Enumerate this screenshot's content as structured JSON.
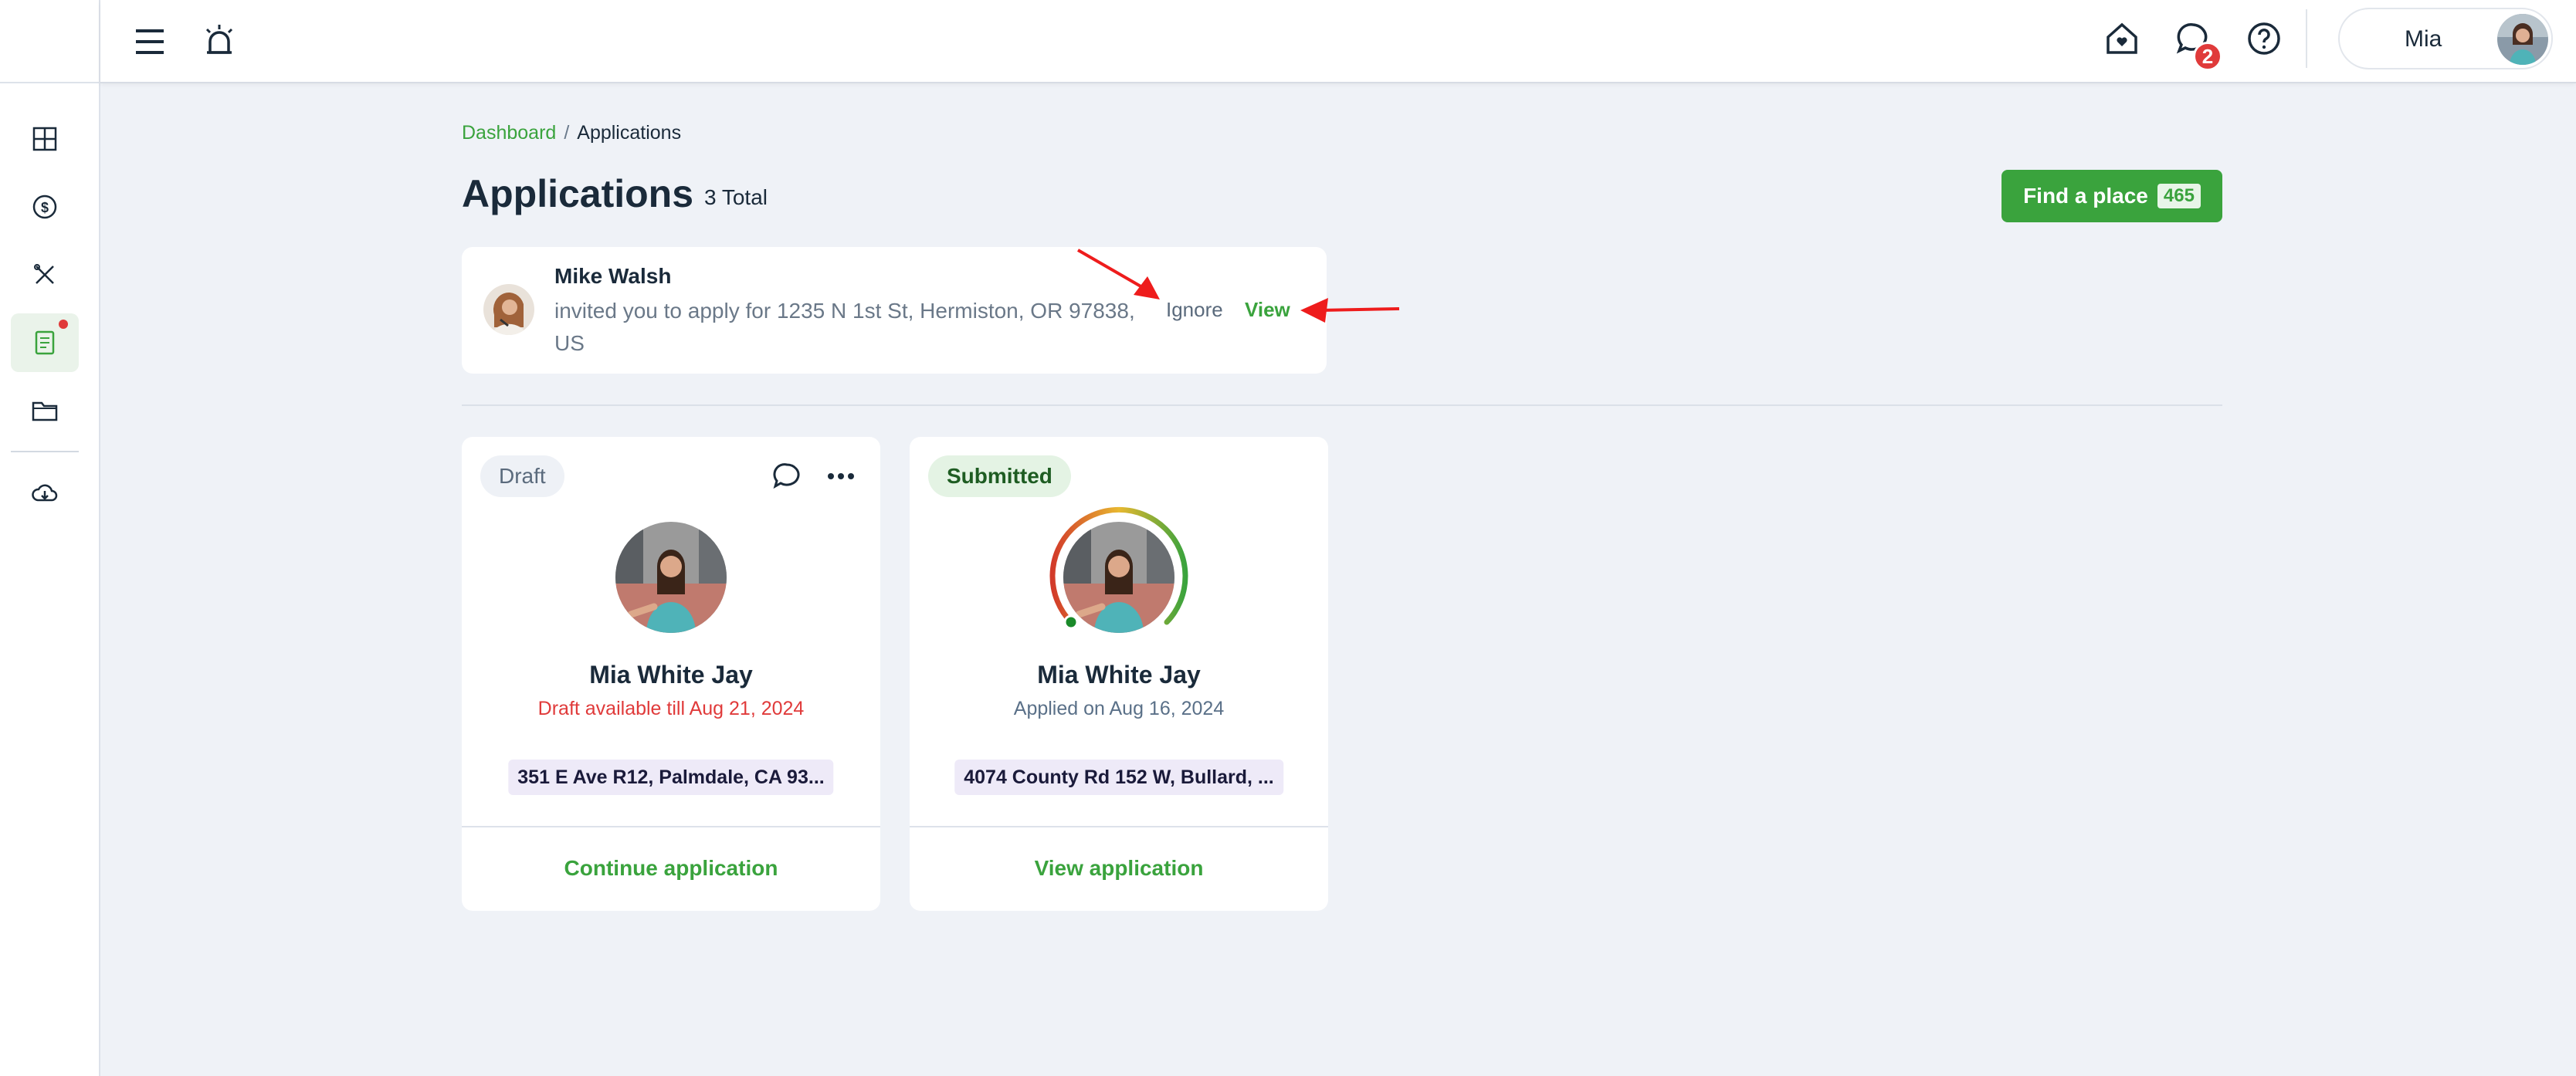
{
  "topbar": {
    "messages_badge": "2",
    "user_name": "Mia"
  },
  "breadcrumb": {
    "items": [
      {
        "label": "Dashboard"
      },
      {
        "label": "Applications"
      }
    ],
    "separator": "/"
  },
  "page": {
    "title": "Applications",
    "total_label": "3 Total",
    "find_button_label": "Find a place",
    "find_button_count": "465"
  },
  "invitation": {
    "sender": "Mike Walsh",
    "message": "invited you to apply for 1235 N 1st St, Hermiston, OR 97838, US",
    "ignore_label": "Ignore",
    "view_label": "View"
  },
  "applications": [
    {
      "status": "Draft",
      "name": "Mia White Jay",
      "subtitle": "Draft available till Aug 21, 2024",
      "address": "351 E Ave R12, Palmdale, CA 93...",
      "action_label": "Continue application"
    },
    {
      "status": "Submitted",
      "name": "Mia White Jay",
      "subtitle": "Applied on Aug 16, 2024",
      "address": "4074 County Rd 152 W, Bullard, ...",
      "action_label": "View application"
    }
  ],
  "sidebar": {
    "items": [
      {
        "icon": "dashboard-grid-icon"
      },
      {
        "icon": "dollar-icon"
      },
      {
        "icon": "tools-icon"
      },
      {
        "icon": "applications-document-icon",
        "active": true,
        "has_dot": true
      },
      {
        "icon": "folder-icon"
      },
      {
        "icon": "cloud-download-icon"
      }
    ]
  },
  "colors": {
    "accent": "#3aa33d",
    "alert": "#e03a3a",
    "background": "#eff2f7",
    "text": "#1a2a3a"
  }
}
